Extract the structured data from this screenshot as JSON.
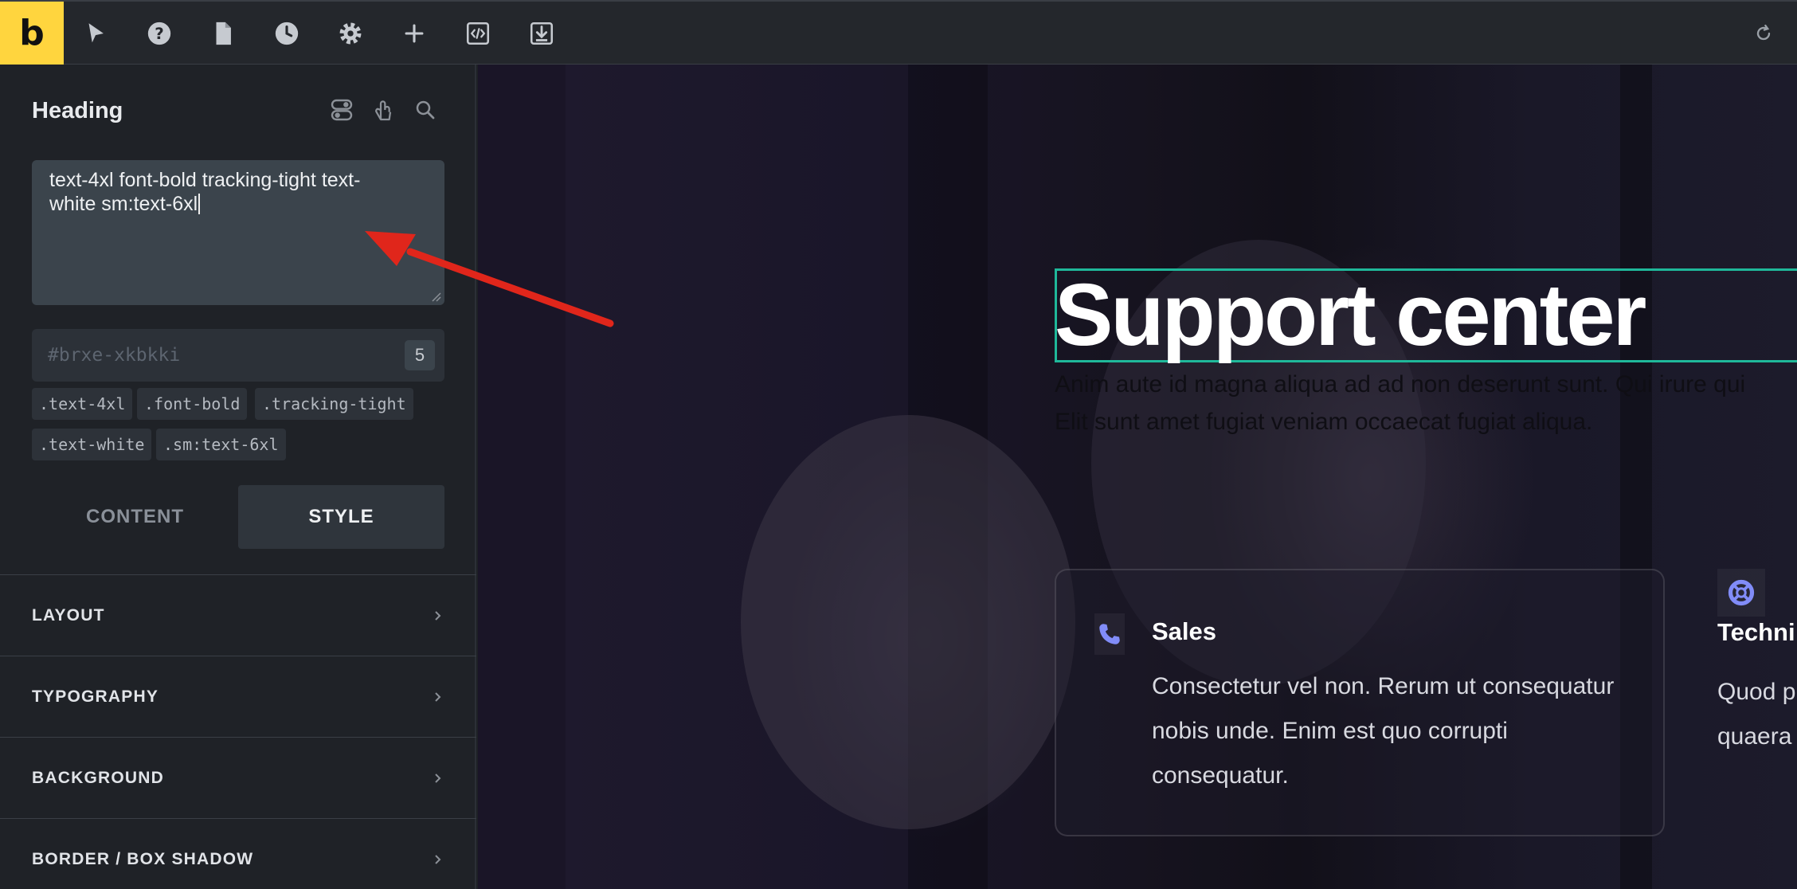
{
  "toolbar": {
    "logo": "b",
    "icons": [
      "pointer-icon",
      "help-icon",
      "page-icon",
      "history-icon",
      "settings-icon",
      "add-icon",
      "code-icon",
      "export-icon",
      "refresh-icon"
    ]
  },
  "panel": {
    "title": "Heading",
    "header_icons": [
      "toggle-icon",
      "hand-pointer-icon",
      "search-icon"
    ],
    "class_input_value": "text-4xl  font-bold tracking-tight text-white sm:text-6xl",
    "class_input_line1": "text-4xl  font-bold tracking-tight text-",
    "class_input_line2": "white sm:text-6xl",
    "id_placeholder": "#brxe-xkbkki",
    "id_count": "5",
    "chips": [
      ".text-4xl",
      ".font-bold",
      ".tracking-tight",
      ".text-white",
      ".sm:text-6xl"
    ],
    "tabs": {
      "content": "CONTENT",
      "style": "STYLE"
    },
    "active_tab": "STYLE",
    "sections": [
      "LAYOUT",
      "TYPOGRAPHY",
      "BACKGROUND",
      "BORDER / BOX SHADOW"
    ]
  },
  "canvas": {
    "heading": "Support center",
    "lead_line1": "Anim aute id magna aliqua ad ad non deserunt sunt. Qui irure qui",
    "lead_line2": "Elit sunt amet fugiat veniam occaecat fugiat aliqua.",
    "card1": {
      "icon": "phone-icon",
      "title": "Sales",
      "body": "Consectetur vel non. Rerum ut consequatur nobis unde. Enim est quo corrupti consequatur."
    },
    "card2": {
      "icon": "lifebuoy-icon",
      "title": "Techni",
      "body_line1": "Quod p",
      "body_line2": "quaera"
    }
  },
  "colors": {
    "brand": "#ffd53e",
    "selection_outline": "#1fb89a",
    "annotation_arrow": "#e0261b",
    "icon_accent": "#818cf8"
  }
}
